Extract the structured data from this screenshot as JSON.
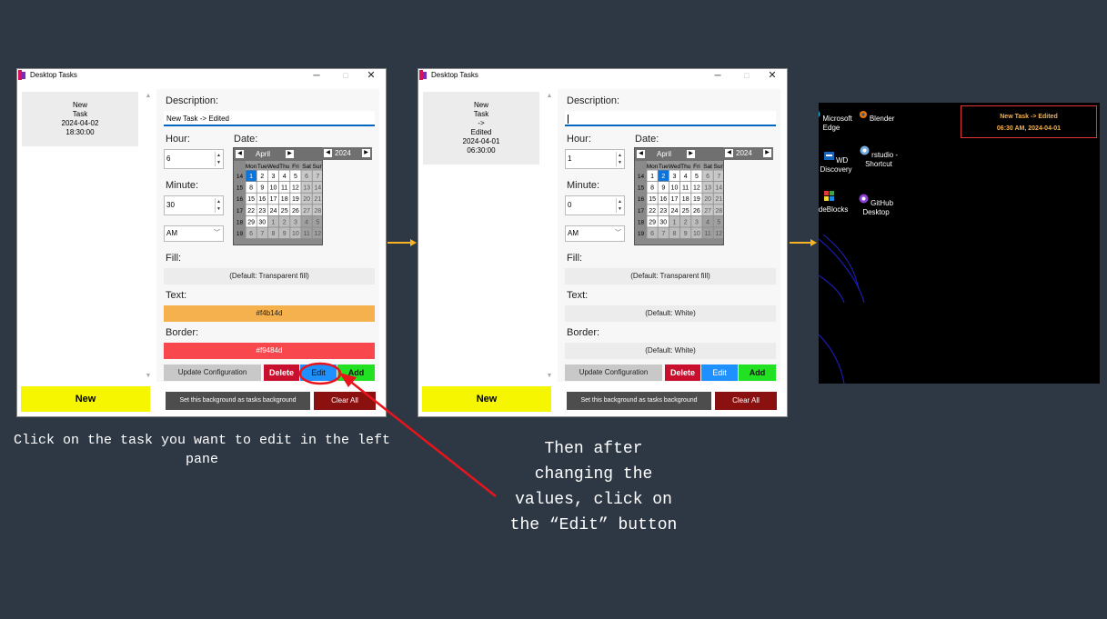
{
  "app": {
    "title": "Desktop Tasks"
  },
  "window1": {
    "task_lines": [
      "New",
      "Task",
      "2024-04-02",
      "18:30:00"
    ],
    "description_label": "Description:",
    "description_value": "New Task -> Edited",
    "hour_label": "Hour:",
    "hour_value": "6",
    "minute_label": "Minute:",
    "minute_value": "30",
    "ampm_value": "AM",
    "date_label": "Date:",
    "calendar": {
      "month": "April",
      "year": "2024",
      "selected_day": "1"
    },
    "fill_label": "Fill:",
    "fill_value": "(Default: Transparent fill)",
    "text_label": "Text:",
    "text_value": "#f4b14d",
    "border_label": "Border:",
    "border_value": "#f9484d",
    "update_button": "Update Configuration",
    "delete_button": "Delete",
    "edit_button": "Edit",
    "add_button": "Add",
    "set_background_button": "Set this background as tasks background",
    "clear_all_button": "Clear All",
    "new_button": "New"
  },
  "window2": {
    "task_lines": [
      "New",
      "Task",
      "->",
      "Edited",
      "2024-04-01",
      "06:30:00"
    ],
    "description_label": "Description:",
    "description_value": "",
    "hour_label": "Hour:",
    "hour_value": "1",
    "minute_label": "Minute:",
    "minute_value": "0",
    "ampm_value": "AM",
    "date_label": "Date:",
    "calendar": {
      "month": "April",
      "year": "2024",
      "selected_day": "2"
    },
    "fill_label": "Fill:",
    "fill_value": "(Default: Transparent fill)",
    "text_label": "Text:",
    "text_value": "(Default: White)",
    "border_label": "Border:",
    "border_value": "(Default: White)",
    "update_button": "Update Configuration",
    "delete_button": "Delete",
    "edit_button": "Edit",
    "add_button": "Add",
    "set_background_button": "Set this background as tasks background",
    "clear_all_button": "Clear All",
    "new_button": "New"
  },
  "calendar_days": {
    "headers": [
      "Mon",
      "Tue",
      "Wed",
      "Thu",
      "Fri",
      "Sat",
      "Sun"
    ],
    "weeks": [
      {
        "num": "14",
        "days": [
          "1",
          "2",
          "3",
          "4",
          "5",
          "6",
          "7"
        ]
      },
      {
        "num": "15",
        "days": [
          "8",
          "9",
          "10",
          "11",
          "12",
          "13",
          "14"
        ]
      },
      {
        "num": "16",
        "days": [
          "15",
          "16",
          "17",
          "18",
          "19",
          "20",
          "21"
        ]
      },
      {
        "num": "17",
        "days": [
          "22",
          "23",
          "24",
          "25",
          "26",
          "27",
          "28"
        ]
      },
      {
        "num": "18",
        "days": [
          "29",
          "30",
          "1",
          "2",
          "3",
          "4",
          "5"
        ]
      },
      {
        "num": "19",
        "days": [
          "6",
          "7",
          "8",
          "9",
          "10",
          "11",
          "12"
        ]
      }
    ]
  },
  "desktop": {
    "icons": [
      {
        "label": "Microsoft Edge",
        "icon": "edge-icon"
      },
      {
        "label": "Blender",
        "icon": "blender-icon"
      },
      {
        "label": "WD Discovery",
        "icon": "wd-discovery-icon"
      },
      {
        "label": "rstudio - Shortcut",
        "icon": "rstudio-icon"
      },
      {
        "label": "CodeBlocks",
        "icon": "codeblocks-icon"
      },
      {
        "label": "GitHub Desktop",
        "icon": "github-desktop-icon"
      }
    ],
    "task_title": "New Task -> Edited",
    "task_time": "06:30 AM, 2024-04-01"
  },
  "captions": {
    "left": "Click on the task you want to edit in the left pane",
    "right": "Then after changing the values, click on the “Edit” button"
  },
  "colors": {
    "background": "#2e3845",
    "new_button": "#f6f600",
    "text_swatch": "#f4b14d",
    "border_swatch": "#f9484d",
    "delete": "#c8102e",
    "edit": "#1e90ff",
    "add": "#22e022",
    "clear_all": "#8b1010",
    "arrow": "#f5b325",
    "annotation": "#e8141c"
  }
}
